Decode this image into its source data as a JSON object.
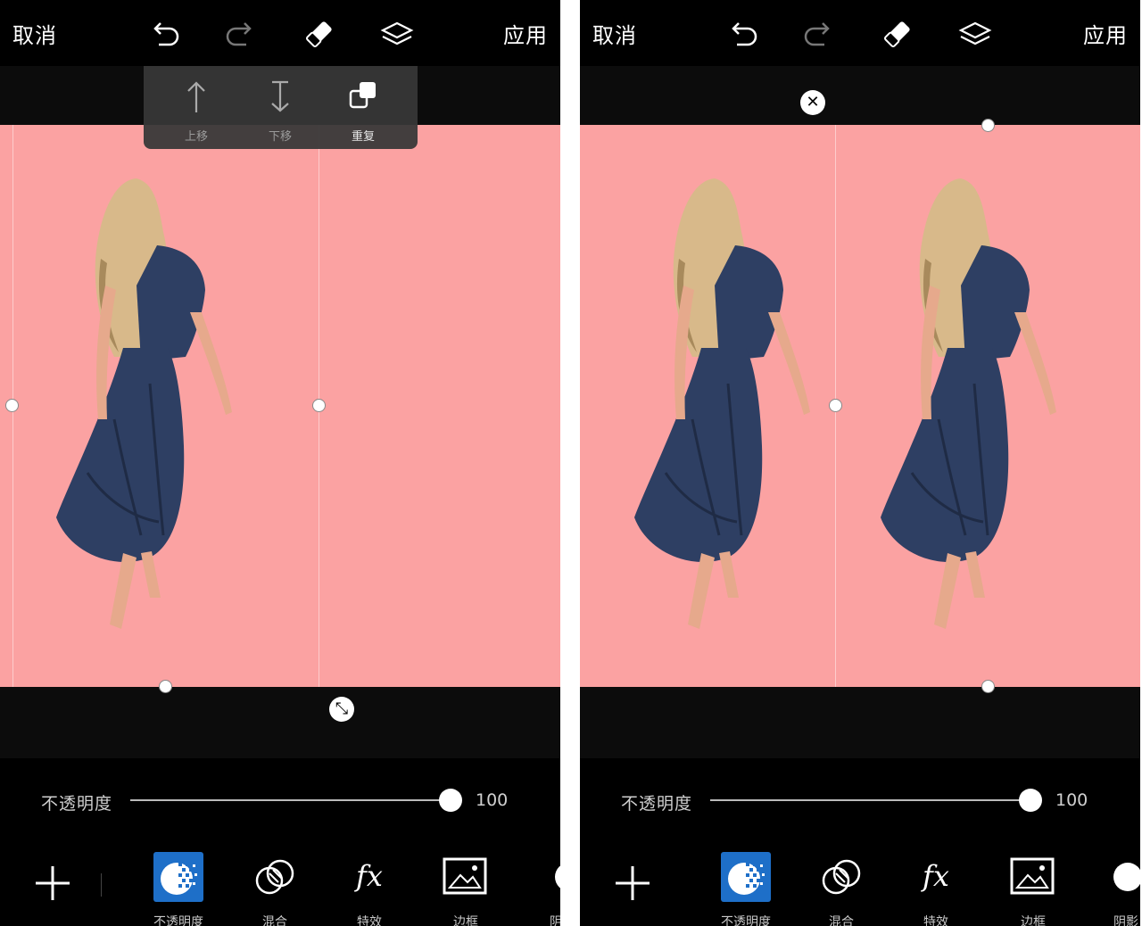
{
  "top_bar": {
    "cancel_label": "取消",
    "apply_label": "应用",
    "icons": [
      "undo-icon",
      "redo-icon",
      "eraser-icon",
      "layers-icon"
    ]
  },
  "layer_menu": {
    "items": [
      {
        "label": "上移",
        "icon": "move-up-icon"
      },
      {
        "label": "下移",
        "icon": "move-down-icon"
      },
      {
        "label": "重复",
        "icon": "duplicate-icon"
      }
    ]
  },
  "canvas": {
    "background_color": "#fba2a2"
  },
  "opacity": {
    "label": "不透明度",
    "value": "100",
    "level_percent": 100
  },
  "toolbar": {
    "add_icon": "plus-icon",
    "tools": [
      {
        "label": "不透明度",
        "icon": "opacity-icon",
        "selected": true
      },
      {
        "label": "混合",
        "icon": "blend-icon"
      },
      {
        "label": "特效",
        "icon": "fx-icon"
      },
      {
        "label": "边框",
        "icon": "border-icon"
      },
      {
        "label": "阴影",
        "icon": "shadow-icon"
      }
    ]
  },
  "colors": {
    "accent": "#1e6fc8",
    "panel_bg": "#000000",
    "canvas": "#fba2a2"
  }
}
